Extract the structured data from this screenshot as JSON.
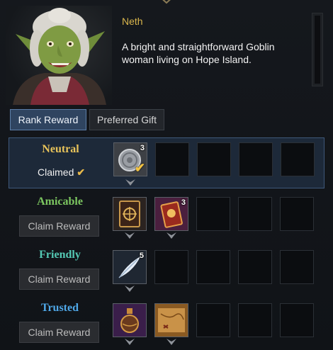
{
  "npc": {
    "name": "Neth",
    "description": "A bright and straightforward Goblin woman living on Hope Island."
  },
  "tabs": [
    {
      "label": "Rank Reward",
      "active": true
    },
    {
      "label": "Preferred Gift",
      "active": false
    }
  ],
  "ranks": [
    {
      "name": "Neutral",
      "color": "#e8c35a",
      "status": "Claimed",
      "check": "✔",
      "items": [
        {
          "icon": "silver-coin-icon",
          "qty": "3",
          "claimed": true
        }
      ]
    },
    {
      "name": "Amicable",
      "color": "#7cc660",
      "button": "Claim Reward",
      "items": [
        {
          "icon": "card-book-icon",
          "qty": ""
        },
        {
          "icon": "red-card-pack-icon",
          "qty": "3"
        }
      ]
    },
    {
      "name": "Friendly",
      "color": "#54c9b4",
      "button": "Claim Reward",
      "items": [
        {
          "icon": "white-feather-icon",
          "qty": "5"
        }
      ]
    },
    {
      "name": "Trusted",
      "color": "#4fa8e8",
      "button": "Claim Reward",
      "items": [
        {
          "icon": "potion-flask-icon",
          "qty": ""
        },
        {
          "icon": "treasure-map-icon",
          "qty": ""
        }
      ]
    }
  ]
}
